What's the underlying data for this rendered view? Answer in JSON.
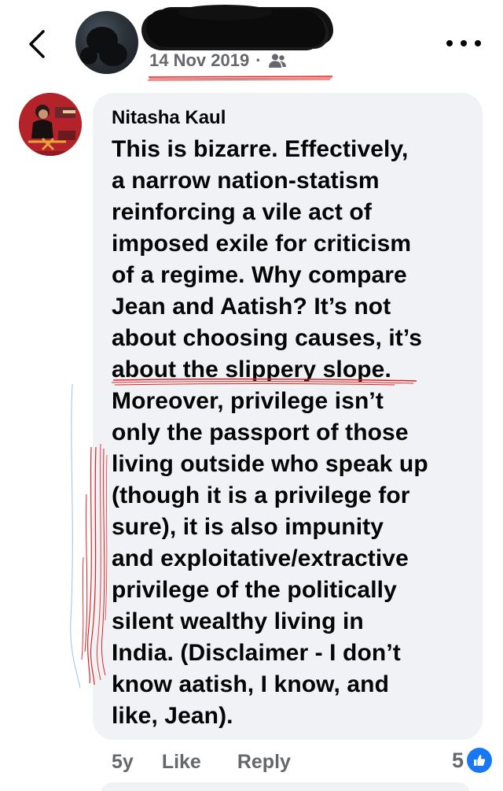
{
  "header": {
    "date": "14 Nov 2019",
    "separator": "·",
    "audience_icon": "friends-icon",
    "back_icon": "chevron-left-icon",
    "more_icon": "more-dots-icon"
  },
  "comment": {
    "author": "Nitasha Kaul",
    "text": "This is bizarre. Effectively,\na narrow nation-statism\nreinforcing a vile act of\nimposed exile for criticism\nof a regime. Why compare\nJean and Aatish? It’s not\nabout choosing causes, it’s\nabout the slippery slope.\nMoreover, privilege isn’t\nonly the passport of those\nliving outside who speak up\n(though it is a privilege for\nsure), it is also impunity\nand exploitative/extractive\nprivilege of the politically\nsilent wealthy living in\nIndia. (Disclaimer - I don’t\nknow aatish, I know, and\nlike, Jean).",
    "age": "5y",
    "like_label": "Like",
    "reply_label": "Reply",
    "reaction_count": "5",
    "reaction_icon": "like-thumb-icon"
  },
  "colors": {
    "bubble": "#f0f2f5",
    "secondary_text": "#65676b",
    "like_blue": "#1877f2",
    "annotation_red": "#e02020"
  }
}
